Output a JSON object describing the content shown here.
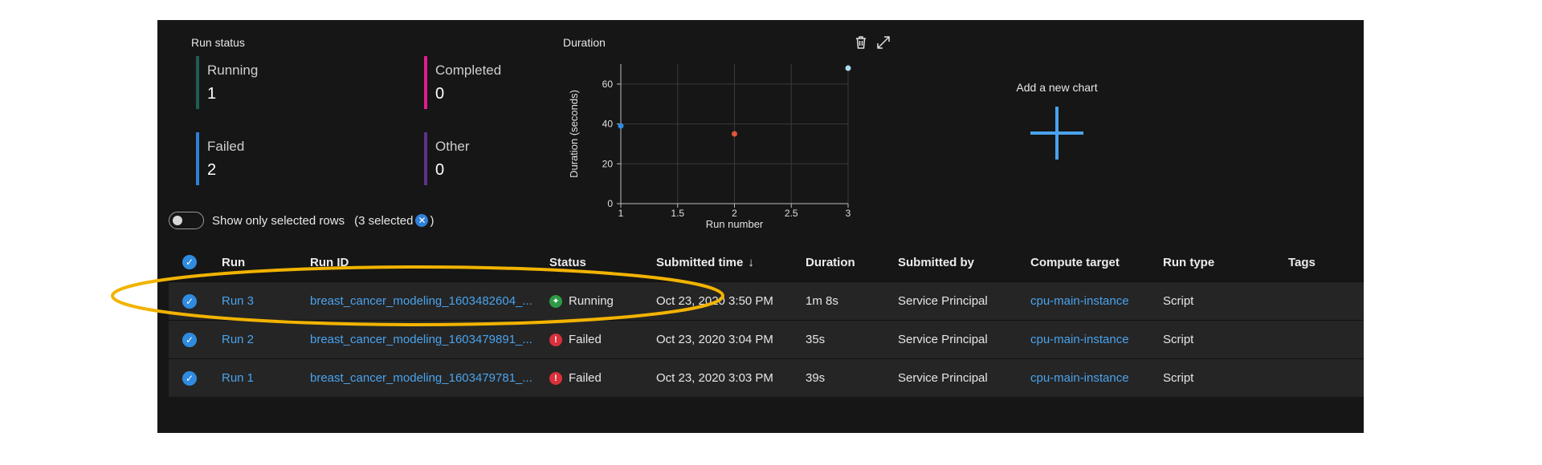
{
  "run_status": {
    "title": "Run status",
    "items": [
      {
        "label": "Running",
        "value": "1",
        "color": "#1f5e55"
      },
      {
        "label": "Completed",
        "value": "0",
        "color": "#e21d8e"
      },
      {
        "label": "Failed",
        "value": "2",
        "color": "#2f80d8"
      },
      {
        "label": "Other",
        "value": "0",
        "color": "#5d3190"
      }
    ]
  },
  "duration_chart": {
    "title": "Duration",
    "tools": {
      "delete_icon": "trash-icon",
      "expand_icon": "expand-icon"
    }
  },
  "chart_data": {
    "type": "scatter",
    "xlabel": "Run number",
    "ylabel": "Duration (seconds)",
    "xlim": [
      1,
      3
    ],
    "ylim": [
      0,
      70
    ],
    "xticks": [
      "1",
      "1.5",
      "2",
      "2.5",
      "3"
    ],
    "yticks": [
      "0",
      "20",
      "40",
      "60"
    ],
    "grid": true,
    "points": [
      {
        "x": 1,
        "y": 39,
        "color": "#2f8be0"
      },
      {
        "x": 2,
        "y": 35,
        "color": "#e0553b"
      },
      {
        "x": 3,
        "y": 68,
        "color": "#a9dcf0"
      }
    ]
  },
  "add_chart": {
    "label": "Add a new chart"
  },
  "filter": {
    "toggle_label": "Show only selected rows",
    "selected_prefix": "(3 selected",
    "selected_suffix": ")"
  },
  "table": {
    "headers": {
      "run": "Run",
      "run_id": "Run ID",
      "status": "Status",
      "submitted_time": "Submitted time",
      "sort_indicator": "↓",
      "duration": "Duration",
      "submitted_by": "Submitted by",
      "compute_target": "Compute target",
      "run_type": "Run type",
      "tags": "Tags"
    },
    "rows": [
      {
        "run": "Run 3",
        "run_id": "breast_cancer_modeling_1603482604_...",
        "status": "Running",
        "status_kind": "running",
        "submitted_time": "Oct 23, 2020 3:50 PM",
        "duration": "1m 8s",
        "submitted_by": "Service Principal",
        "compute_target": "cpu-main-instance",
        "run_type": "Script"
      },
      {
        "run": "Run 2",
        "run_id": "breast_cancer_modeling_1603479891_...",
        "status": "Failed",
        "status_kind": "failed",
        "submitted_time": "Oct 23, 2020 3:04 PM",
        "duration": "35s",
        "submitted_by": "Service Principal",
        "compute_target": "cpu-main-instance",
        "run_type": "Script"
      },
      {
        "run": "Run 1",
        "run_id": "breast_cancer_modeling_1603479781_...",
        "status": "Failed",
        "status_kind": "failed",
        "submitted_time": "Oct 23, 2020 3:03 PM",
        "duration": "39s",
        "submitted_by": "Service Principal",
        "compute_target": "cpu-main-instance",
        "run_type": "Script"
      }
    ]
  },
  "annotation": {
    "color": "#f2b300"
  }
}
